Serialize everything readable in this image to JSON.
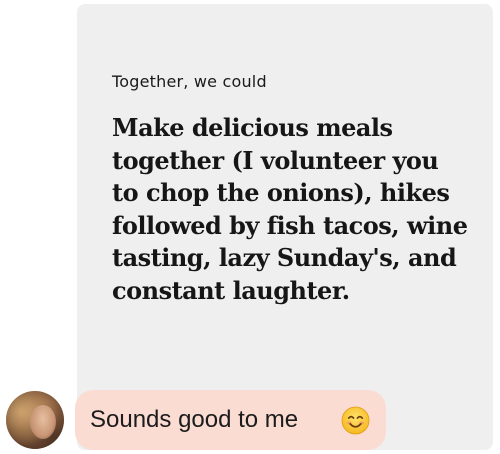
{
  "prompt": {
    "label": "Together, we could",
    "answer_lines": [
      "Make delicious meals",
      "together (I volunteer you",
      "to chop the onions), hikes",
      "followed by fish tacos, wine",
      "tasting, lazy Sunday's, and",
      "constant laughter."
    ]
  },
  "reply": {
    "text": "Sounds good to me",
    "emoji_icon": "smiling-face-icon"
  },
  "colors": {
    "card_background": "#efefef",
    "reply_bubble": "#fbdcd3",
    "text": "#161616"
  }
}
